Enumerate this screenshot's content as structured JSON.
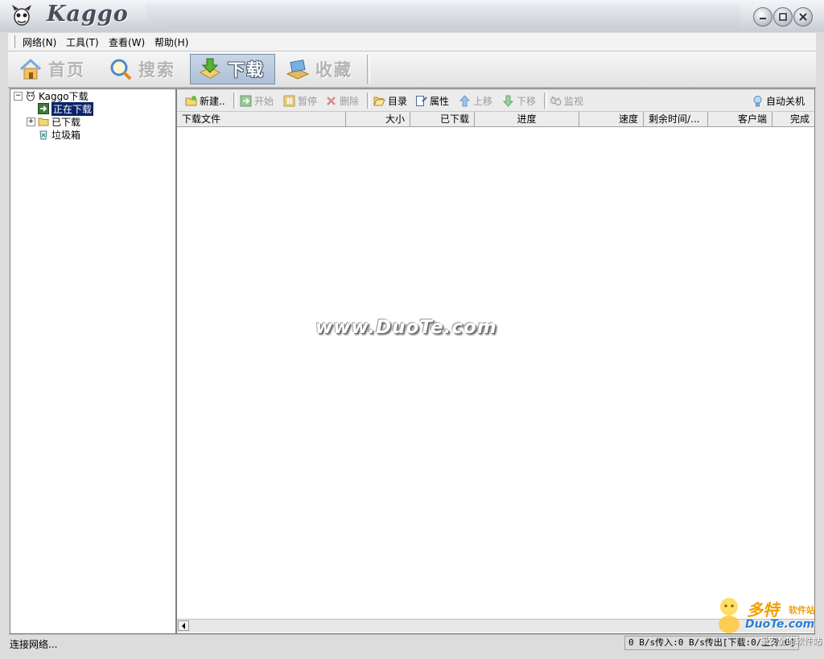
{
  "app": {
    "title": "Kaggo"
  },
  "menu": [
    "网络(N)",
    "工具(T)",
    "查看(W)",
    "帮助(H)"
  ],
  "nav": [
    {
      "label": "首页",
      "active": false
    },
    {
      "label": "搜索",
      "active": false
    },
    {
      "label": "下载",
      "active": true
    },
    {
      "label": "收藏",
      "active": false
    }
  ],
  "tree": {
    "root": "Kaggo下载",
    "items": [
      "正在下载",
      "已下载",
      "垃圾箱"
    ],
    "expander_collapsed": "+",
    "expander_expanded": "−"
  },
  "toolbar": {
    "new": "新建..",
    "start": "开始",
    "pause": "暂停",
    "delete": "删除",
    "folder": "目录",
    "properties": "属性",
    "move_up": "上移",
    "move_down": "下移",
    "monitor": "监视",
    "auto_shutdown": "自动关机"
  },
  "columns": [
    "下载文件",
    "大小",
    "已下载",
    "进度",
    "速度",
    "剩余时间/...",
    "客户端",
    "完成"
  ],
  "watermark": "www.DuoTe.com",
  "status": {
    "left": "连接网络...",
    "right": "0 B/s传入:0 B/s传出[下载:0/上传:0]"
  },
  "corner_logo": {
    "big": "多特",
    "small": "软件站",
    "site": "DuoTe.com",
    "tag": "最安全的软件站"
  },
  "colors": {
    "selection": "#0a246a",
    "accent": "#f0a000",
    "link_blue": "#2f7fd0"
  }
}
